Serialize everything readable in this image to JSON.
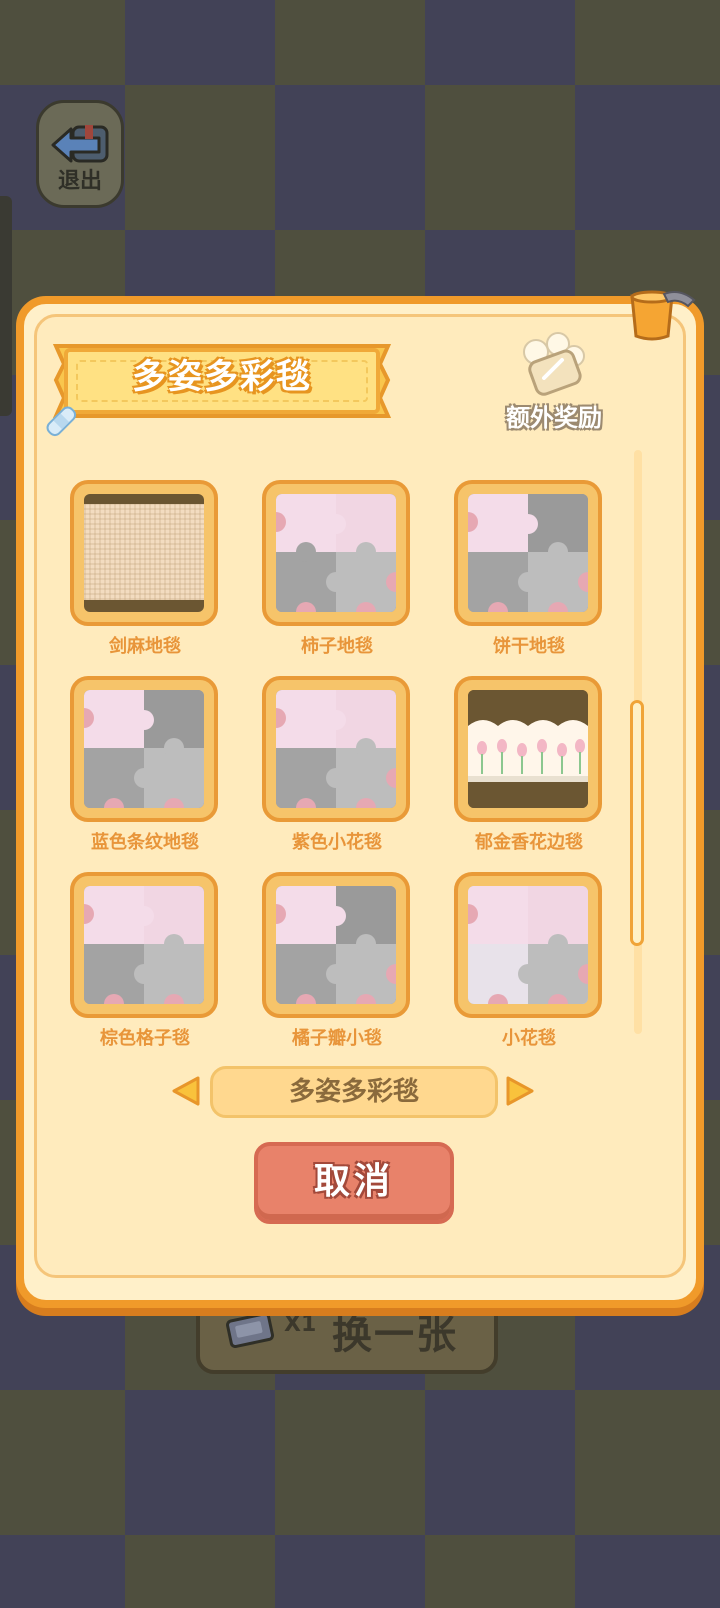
{
  "exit": {
    "label": "退出"
  },
  "dialog": {
    "title": "多姿多彩毯",
    "bonus_label": "额外奖励",
    "category": "多姿多彩毯",
    "cancel_label": "取消"
  },
  "rugs": [
    {
      "name": "剑麻地毯",
      "style": "sisal"
    },
    {
      "name": "柿子地毯",
      "style": "puzzle-locked"
    },
    {
      "name": "饼干地毯",
      "style": "puzzle-locked"
    },
    {
      "name": "蓝色条纹地毯",
      "style": "puzzle-locked"
    },
    {
      "name": "紫色小花毯",
      "style": "puzzle-locked"
    },
    {
      "name": "郁金香花边毯",
      "style": "tulip"
    },
    {
      "name": "棕色格子毯",
      "style": "puzzle-locked"
    },
    {
      "name": "橘子瓣小毯",
      "style": "puzzle-locked"
    },
    {
      "name": "小花毯",
      "style": "puzzle-locked"
    }
  ],
  "swap": {
    "count": "X1",
    "label": "换一张"
  },
  "colors": {
    "dialog_border": "#f09a2a",
    "dialog_bg": "#fff0c9",
    "tile_label": "#e8953a",
    "cancel": "#e8826a"
  }
}
